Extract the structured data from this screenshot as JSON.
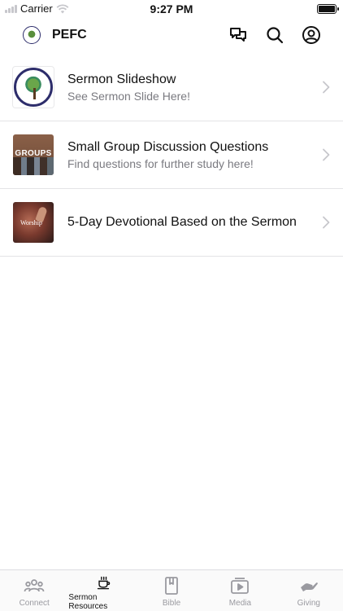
{
  "status_bar": {
    "carrier": "Carrier",
    "time": "9:27 PM"
  },
  "header": {
    "title": "PEFC"
  },
  "items": [
    {
      "title": "Sermon Slideshow",
      "subtitle": "See Sermon Slide Here!",
      "thumb": "church-logo"
    },
    {
      "title": "Small Group Discussion Questions",
      "subtitle": "Find questions for further study here!",
      "thumb": "groups",
      "thumb_label": "GROUPS"
    },
    {
      "title": "5-Day Devotional Based on the Sermon",
      "subtitle": "",
      "thumb": "worship",
      "thumb_label": "Worship"
    }
  ],
  "tabs": [
    {
      "label": "Connect",
      "icon": "people-icon",
      "active": false
    },
    {
      "label": "Sermon Resources",
      "icon": "coffee-cup-icon",
      "active": true
    },
    {
      "label": "Bible",
      "icon": "book-icon",
      "active": false
    },
    {
      "label": "Media",
      "icon": "play-icon",
      "active": false
    },
    {
      "label": "Giving",
      "icon": "giving-hand-icon",
      "active": false
    }
  ],
  "colors": {
    "accent_active": "#111111",
    "inactive": "#9a9aa0",
    "divider": "#e3e3e6"
  }
}
